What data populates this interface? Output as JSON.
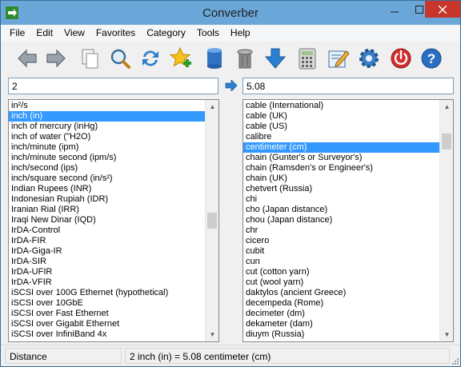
{
  "window": {
    "title": "Converber"
  },
  "menu": [
    "File",
    "Edit",
    "View",
    "Favorites",
    "Category",
    "Tools",
    "Help"
  ],
  "toolbar": [
    {
      "icon": "back-arrow-icon"
    },
    {
      "icon": "forward-arrow-icon"
    },
    {
      "icon": "copy-icon"
    },
    {
      "icon": "search-icon"
    },
    {
      "icon": "swap-icon"
    },
    {
      "icon": "add-favorite-icon"
    },
    {
      "icon": "database-icon"
    },
    {
      "icon": "trash-icon"
    },
    {
      "icon": "download-icon"
    },
    {
      "icon": "calculator-icon"
    },
    {
      "icon": "edit-icon"
    },
    {
      "icon": "settings-icon"
    },
    {
      "icon": "power-icon"
    },
    {
      "icon": "help-icon"
    }
  ],
  "input": {
    "from_value": "2",
    "to_value": "5.08"
  },
  "left_list": {
    "selected_index": 1,
    "scroll_position": 0.5,
    "items": [
      "in²/s",
      "inch (in)",
      "inch of mercury (inHg)",
      "inch of water (\"H2O)",
      "inch/minute (ipm)",
      "inch/minute second (ipm/s)",
      "inch/second (ips)",
      "inch/square second (in/s²)",
      "Indian Rupees (INR)",
      "Indonesian Rupiah (IDR)",
      "Iranian Rial (IRR)",
      "Iraqi New Dinar (IQD)",
      "IrDA-Control",
      "IrDA-FIR",
      "IrDA-Giga-IR",
      "IrDA-SIR",
      "IrDA-UFIR",
      "IrDA-VFIR",
      "iSCSI over 100G Ethernet (hypothetical)",
      "iSCSI over 10GbE",
      "iSCSI over Fast Ethernet",
      "iSCSI over Gigabit Ethernet",
      "iSCSI over InfiniBand 4x"
    ]
  },
  "right_list": {
    "selected_index": 4,
    "scroll_position": 0.1,
    "items": [
      "cable (International)",
      "cable (UK)",
      "cable (US)",
      "calibre",
      "centimeter (cm)",
      "chain (Gunter's or Surveyor's)",
      "chain (Ramsden's or Engineer's)",
      "chain (UK)",
      "chetvert (Russia)",
      "chi",
      "cho (Japan distance)",
      "chou (Japan distance)",
      "chr",
      "cicero",
      "cubit",
      "cun",
      "cut (cotton yarn)",
      "cut (wool yarn)",
      "daktylos (ancient Greece)",
      "decempeda (Rome)",
      "decimeter (dm)",
      "dekameter (dam)",
      "diuym (Russia)"
    ]
  },
  "status": {
    "category": "Distance",
    "result": "2 inch (in) = 5.08 centimeter (cm)"
  }
}
